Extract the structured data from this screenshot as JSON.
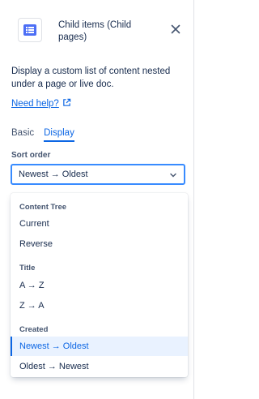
{
  "header": {
    "title": "Child items (Child pages)",
    "icon": "list-icon",
    "close_icon": "close-icon"
  },
  "description": "Display a custom list of content nested under a page or live doc.",
  "help_link": {
    "label": "Need help?",
    "icon": "external-link-icon"
  },
  "tabs": [
    {
      "label": "Basic",
      "active": false
    },
    {
      "label": "Display",
      "active": true
    }
  ],
  "sort": {
    "label": "Sort order",
    "value": "Newest → Oldest",
    "groups": [
      {
        "heading": "Content Tree",
        "options": [
          "Current",
          "Reverse"
        ]
      },
      {
        "heading": "Title",
        "options": [
          "A → Z",
          "Z → A"
        ]
      },
      {
        "heading": "Created",
        "options": [
          "Newest → Oldest",
          "Oldest → Newest"
        ]
      }
    ],
    "selected": "Newest → Oldest"
  },
  "colors": {
    "accent": "#0c66e4",
    "focus_border": "#388bff",
    "selected_bg": "#e9f2ff"
  }
}
